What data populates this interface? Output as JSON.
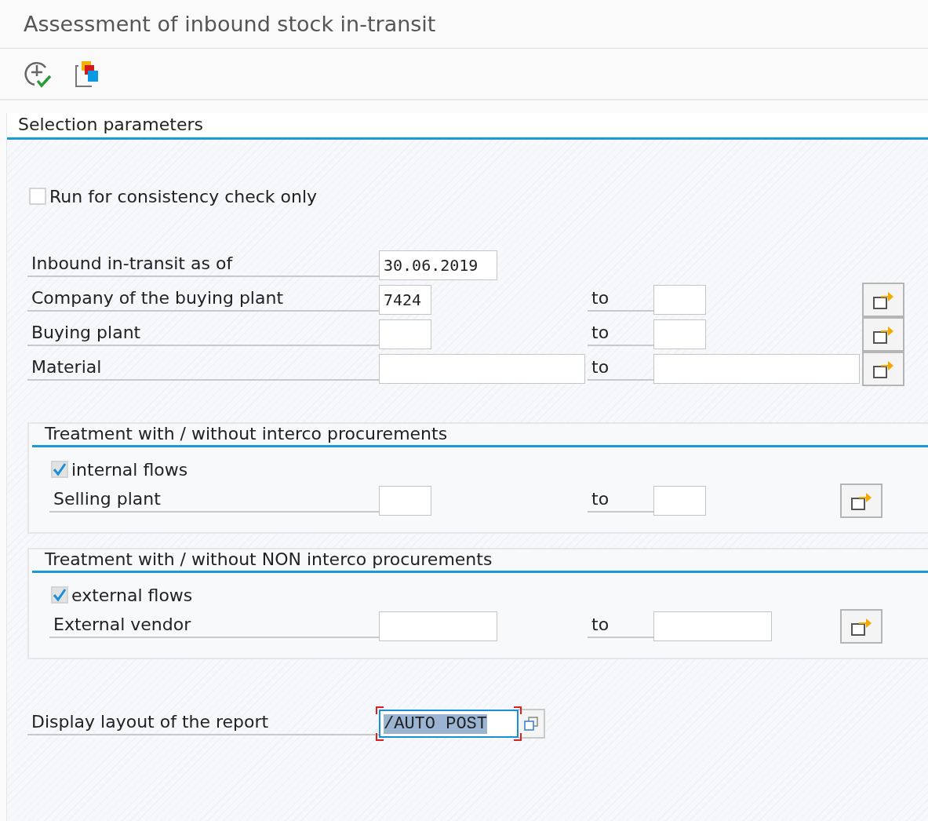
{
  "window": {
    "title": "Assessment of inbound stock in-transit"
  },
  "toolbar": [
    {
      "kind": "execute"
    },
    {
      "kind": "variants"
    }
  ],
  "section": {
    "title": "Selection parameters"
  },
  "consistency_check": {
    "label": "Run for consistency check only",
    "checked": false
  },
  "parameters": [
    {
      "label": "Inbound in-transit as of",
      "value": "30.06.2019"
    },
    {
      "label": "Company of the buying plant",
      "value": "7424",
      "to": "to"
    },
    {
      "label": "Buying plant",
      "to": "to"
    },
    {
      "label": "Material",
      "to": "to"
    }
  ],
  "groups": [
    {
      "title": "Treatment with / without interco procurements",
      "flow": {
        "label": "internal flows",
        "checked": true
      },
      "parameters": [
        {
          "label": "Selling plant",
          "to": "to"
        }
      ]
    },
    {
      "title": "Treatment with / without NON interco procurements",
      "flow": {
        "label": "external flows",
        "checked": true
      },
      "parameters": [
        {
          "label": "External vendor",
          "to": "to"
        }
      ]
    }
  ],
  "layout": {
    "label": "Display layout of the report",
    "value": "/AUTO POST",
    "focused": true
  }
}
